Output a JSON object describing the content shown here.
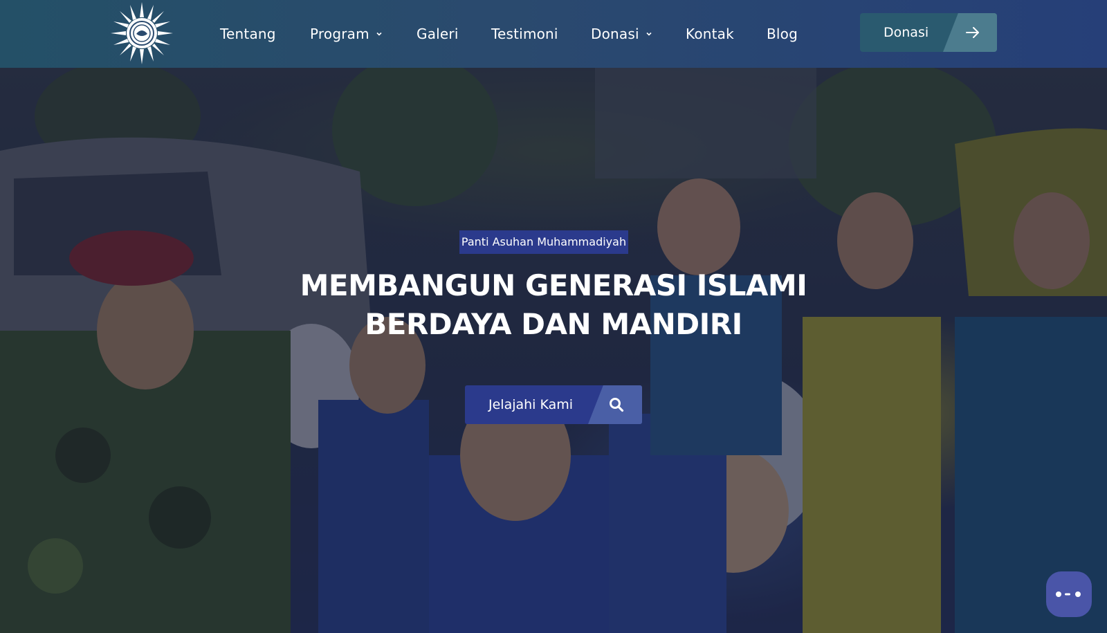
{
  "header": {
    "logo_icon": "muhammadiyah-sun-emblem-icon",
    "nav": [
      {
        "label": "Tentang",
        "has_dropdown": false
      },
      {
        "label": "Program",
        "has_dropdown": true
      },
      {
        "label": "Galeri",
        "has_dropdown": false
      },
      {
        "label": "Testimoni",
        "has_dropdown": false
      },
      {
        "label": "Donasi",
        "has_dropdown": true
      },
      {
        "label": "Kontak",
        "has_dropdown": false
      },
      {
        "label": "Blog",
        "has_dropdown": false
      }
    ],
    "cta": {
      "label": "Donasi",
      "icon": "arrow-right-icon"
    }
  },
  "hero": {
    "tag": "Panti Asuhan Muhammadiyah",
    "headline_line1": "MEMBANGUN GENERASI ISLAMI",
    "headline_line2": "BERDAYA DAN MANDIRI",
    "cta": {
      "label": "Jelajahi Kami",
      "icon": "search-icon"
    }
  },
  "chat_widget": {
    "icon": "chat-bubble-dots-icon"
  },
  "colors": {
    "header_start": "#245067",
    "header_end": "#263f78",
    "primary": "#2b3a8c",
    "header_button": "#2a5a6f",
    "chat_button": "#4a55a8"
  }
}
